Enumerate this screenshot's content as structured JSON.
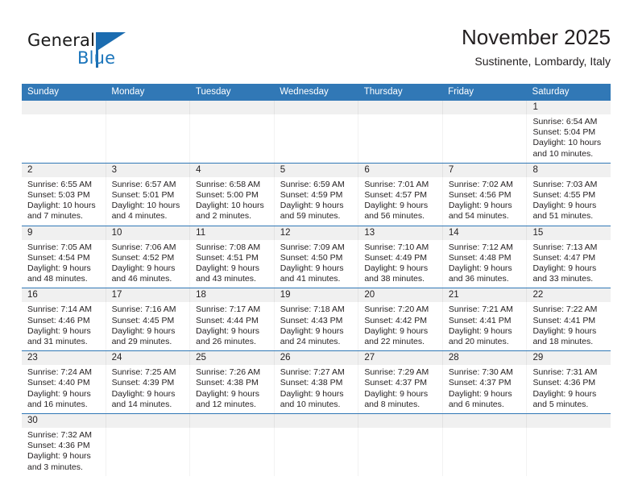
{
  "brand": {
    "name_top": "General",
    "name_bottom": "Blue",
    "accent_color": "#1b6cb0"
  },
  "header": {
    "title": "November 2025",
    "subtitle": "Sustinente, Lombardy, Italy"
  },
  "theme": {
    "header_blue": "#3178b6",
    "date_band": "#f0f0f0",
    "text": "#231f20"
  },
  "weekdays": [
    "Sunday",
    "Monday",
    "Tuesday",
    "Wednesday",
    "Thursday",
    "Friday",
    "Saturday"
  ],
  "weeks": [
    [
      {
        "day": "",
        "lines": []
      },
      {
        "day": "",
        "lines": []
      },
      {
        "day": "",
        "lines": []
      },
      {
        "day": "",
        "lines": []
      },
      {
        "day": "",
        "lines": []
      },
      {
        "day": "",
        "lines": []
      },
      {
        "day": "1",
        "lines": [
          "Sunrise: 6:54 AM",
          "Sunset: 5:04 PM",
          "Daylight: 10 hours",
          "and 10 minutes."
        ]
      }
    ],
    [
      {
        "day": "2",
        "lines": [
          "Sunrise: 6:55 AM",
          "Sunset: 5:03 PM",
          "Daylight: 10 hours",
          "and 7 minutes."
        ]
      },
      {
        "day": "3",
        "lines": [
          "Sunrise: 6:57 AM",
          "Sunset: 5:01 PM",
          "Daylight: 10 hours",
          "and 4 minutes."
        ]
      },
      {
        "day": "4",
        "lines": [
          "Sunrise: 6:58 AM",
          "Sunset: 5:00 PM",
          "Daylight: 10 hours",
          "and 2 minutes."
        ]
      },
      {
        "day": "5",
        "lines": [
          "Sunrise: 6:59 AM",
          "Sunset: 4:59 PM",
          "Daylight: 9 hours",
          "and 59 minutes."
        ]
      },
      {
        "day": "6",
        "lines": [
          "Sunrise: 7:01 AM",
          "Sunset: 4:57 PM",
          "Daylight: 9 hours",
          "and 56 minutes."
        ]
      },
      {
        "day": "7",
        "lines": [
          "Sunrise: 7:02 AM",
          "Sunset: 4:56 PM",
          "Daylight: 9 hours",
          "and 54 minutes."
        ]
      },
      {
        "day": "8",
        "lines": [
          "Sunrise: 7:03 AM",
          "Sunset: 4:55 PM",
          "Daylight: 9 hours",
          "and 51 minutes."
        ]
      }
    ],
    [
      {
        "day": "9",
        "lines": [
          "Sunrise: 7:05 AM",
          "Sunset: 4:54 PM",
          "Daylight: 9 hours",
          "and 48 minutes."
        ]
      },
      {
        "day": "10",
        "lines": [
          "Sunrise: 7:06 AM",
          "Sunset: 4:52 PM",
          "Daylight: 9 hours",
          "and 46 minutes."
        ]
      },
      {
        "day": "11",
        "lines": [
          "Sunrise: 7:08 AM",
          "Sunset: 4:51 PM",
          "Daylight: 9 hours",
          "and 43 minutes."
        ]
      },
      {
        "day": "12",
        "lines": [
          "Sunrise: 7:09 AM",
          "Sunset: 4:50 PM",
          "Daylight: 9 hours",
          "and 41 minutes."
        ]
      },
      {
        "day": "13",
        "lines": [
          "Sunrise: 7:10 AM",
          "Sunset: 4:49 PM",
          "Daylight: 9 hours",
          "and 38 minutes."
        ]
      },
      {
        "day": "14",
        "lines": [
          "Sunrise: 7:12 AM",
          "Sunset: 4:48 PM",
          "Daylight: 9 hours",
          "and 36 minutes."
        ]
      },
      {
        "day": "15",
        "lines": [
          "Sunrise: 7:13 AM",
          "Sunset: 4:47 PM",
          "Daylight: 9 hours",
          "and 33 minutes."
        ]
      }
    ],
    [
      {
        "day": "16",
        "lines": [
          "Sunrise: 7:14 AM",
          "Sunset: 4:46 PM",
          "Daylight: 9 hours",
          "and 31 minutes."
        ]
      },
      {
        "day": "17",
        "lines": [
          "Sunrise: 7:16 AM",
          "Sunset: 4:45 PM",
          "Daylight: 9 hours",
          "and 29 minutes."
        ]
      },
      {
        "day": "18",
        "lines": [
          "Sunrise: 7:17 AM",
          "Sunset: 4:44 PM",
          "Daylight: 9 hours",
          "and 26 minutes."
        ]
      },
      {
        "day": "19",
        "lines": [
          "Sunrise: 7:18 AM",
          "Sunset: 4:43 PM",
          "Daylight: 9 hours",
          "and 24 minutes."
        ]
      },
      {
        "day": "20",
        "lines": [
          "Sunrise: 7:20 AM",
          "Sunset: 4:42 PM",
          "Daylight: 9 hours",
          "and 22 minutes."
        ]
      },
      {
        "day": "21",
        "lines": [
          "Sunrise: 7:21 AM",
          "Sunset: 4:41 PM",
          "Daylight: 9 hours",
          "and 20 minutes."
        ]
      },
      {
        "day": "22",
        "lines": [
          "Sunrise: 7:22 AM",
          "Sunset: 4:41 PM",
          "Daylight: 9 hours",
          "and 18 minutes."
        ]
      }
    ],
    [
      {
        "day": "23",
        "lines": [
          "Sunrise: 7:24 AM",
          "Sunset: 4:40 PM",
          "Daylight: 9 hours",
          "and 16 minutes."
        ]
      },
      {
        "day": "24",
        "lines": [
          "Sunrise: 7:25 AM",
          "Sunset: 4:39 PM",
          "Daylight: 9 hours",
          "and 14 minutes."
        ]
      },
      {
        "day": "25",
        "lines": [
          "Sunrise: 7:26 AM",
          "Sunset: 4:38 PM",
          "Daylight: 9 hours",
          "and 12 minutes."
        ]
      },
      {
        "day": "26",
        "lines": [
          "Sunrise: 7:27 AM",
          "Sunset: 4:38 PM",
          "Daylight: 9 hours",
          "and 10 minutes."
        ]
      },
      {
        "day": "27",
        "lines": [
          "Sunrise: 7:29 AM",
          "Sunset: 4:37 PM",
          "Daylight: 9 hours",
          "and 8 minutes."
        ]
      },
      {
        "day": "28",
        "lines": [
          "Sunrise: 7:30 AM",
          "Sunset: 4:37 PM",
          "Daylight: 9 hours",
          "and 6 minutes."
        ]
      },
      {
        "day": "29",
        "lines": [
          "Sunrise: 7:31 AM",
          "Sunset: 4:36 PM",
          "Daylight: 9 hours",
          "and 5 minutes."
        ]
      }
    ],
    [
      {
        "day": "30",
        "lines": [
          "Sunrise: 7:32 AM",
          "Sunset: 4:36 PM",
          "Daylight: 9 hours",
          "and 3 minutes."
        ]
      },
      {
        "day": "",
        "lines": []
      },
      {
        "day": "",
        "lines": []
      },
      {
        "day": "",
        "lines": []
      },
      {
        "day": "",
        "lines": []
      },
      {
        "day": "",
        "lines": []
      },
      {
        "day": "",
        "lines": []
      }
    ]
  ]
}
